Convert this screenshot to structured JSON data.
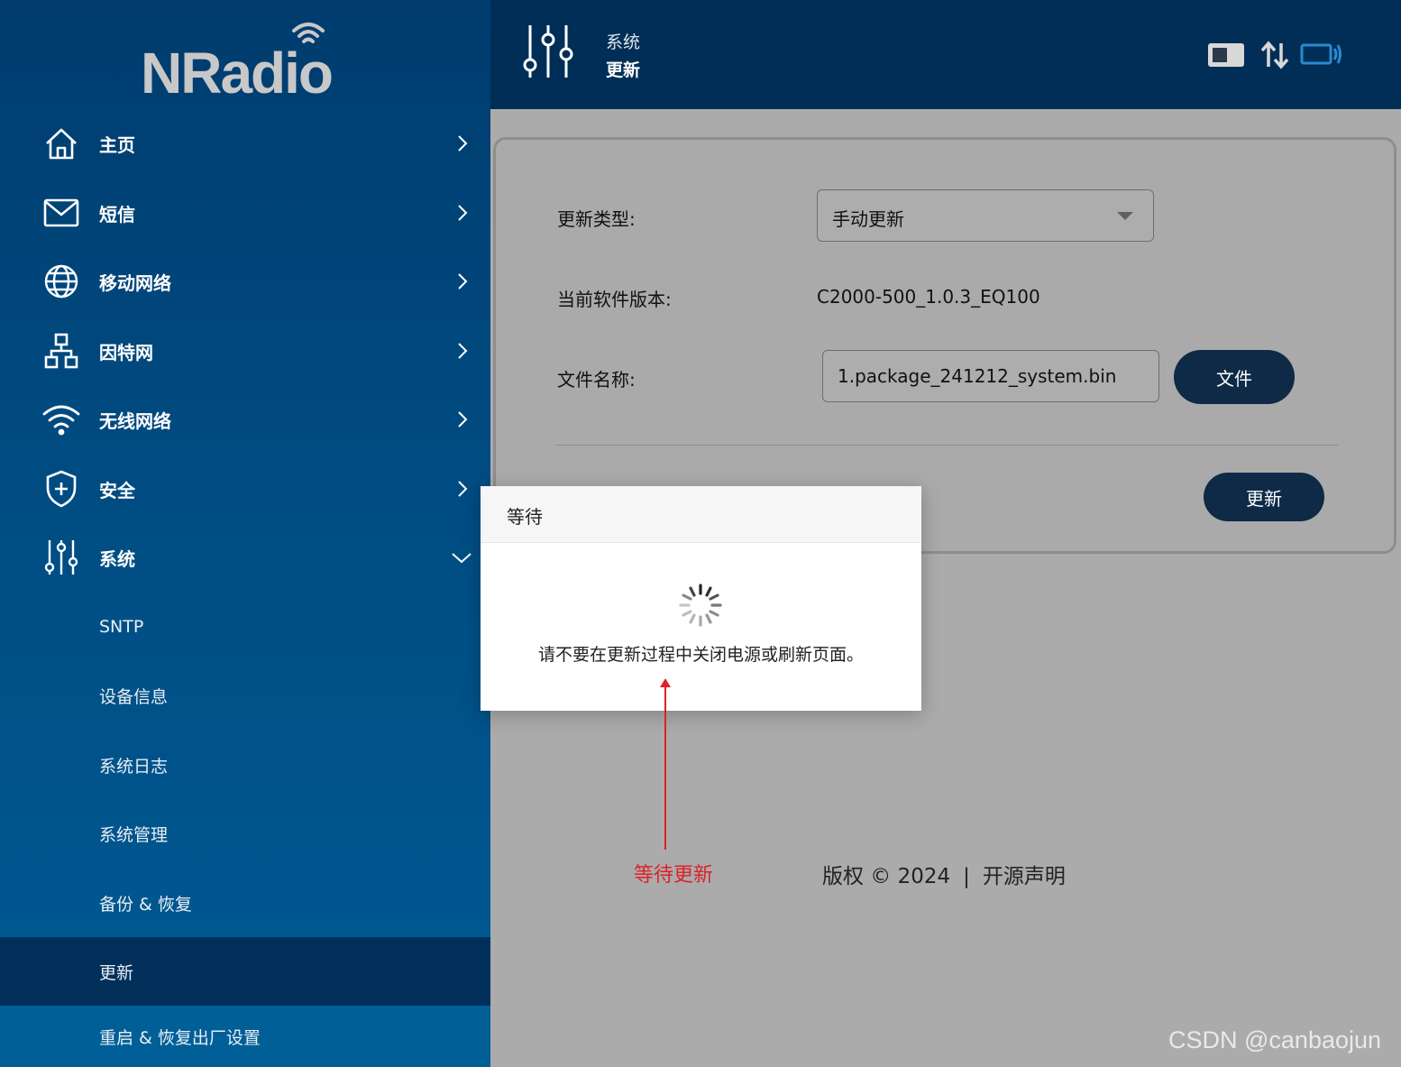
{
  "brand": {
    "logo_text": "NRadio"
  },
  "sidebar": {
    "items": [
      {
        "label": "主页",
        "icon": "home-icon"
      },
      {
        "label": "短信",
        "icon": "mail-icon"
      },
      {
        "label": "移动网络",
        "icon": "globe-icon"
      },
      {
        "label": "因特网",
        "icon": "network-icon"
      },
      {
        "label": "无线网络",
        "icon": "wifi-icon"
      },
      {
        "label": "安全",
        "icon": "shield-icon"
      },
      {
        "label": "系统",
        "icon": "sliders-icon",
        "expanded": true
      }
    ],
    "sub_items": [
      {
        "label": "SNTP"
      },
      {
        "label": "设备信息"
      },
      {
        "label": "系统日志"
      },
      {
        "label": "系统管理"
      },
      {
        "label": "备份 & 恢复"
      },
      {
        "label": "更新",
        "active": true
      },
      {
        "label": "重启 & 恢复出厂设置"
      }
    ]
  },
  "header": {
    "category": "系统",
    "title": "更新"
  },
  "form": {
    "update_type_label": "更新类型:",
    "update_type_value": "手动更新",
    "version_label": "当前软件版本:",
    "version_value": "C2000-500_1.0.3_EQ100",
    "file_label": "文件名称:",
    "file_value": "1.package_241212_system.bin",
    "file_button": "文件",
    "update_button": "更新"
  },
  "dialog": {
    "title": "等待",
    "message": "请不要在更新过程中关闭电源或刷新页面。"
  },
  "annotation": {
    "text": "等待更新"
  },
  "footer": {
    "copyright": "版权 © 2024",
    "separator": "|",
    "open_source": "开源声明"
  },
  "watermark": "CSDN @canbaojun",
  "colors": {
    "sidebar_top": "#003c6e",
    "header_bg": "#002e56",
    "button_bg": "#0e2a47",
    "annotation": "#e0202a"
  }
}
